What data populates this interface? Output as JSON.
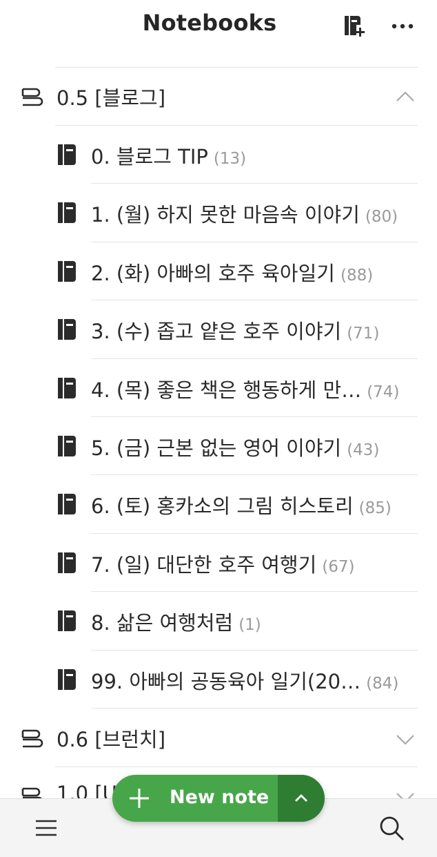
{
  "header": {
    "title": "Notebooks",
    "add_notebook_icon": "new-notebook-icon",
    "more_icon": "more-horizontal-icon"
  },
  "stacks": [
    {
      "label": "0.5 [블로그]",
      "expanded": true,
      "chevron": "chevron-up-icon"
    },
    {
      "label": "0.6 [브런치]",
      "expanded": false,
      "chevron": "chevron-down-icon"
    },
    {
      "label": "1.0 [U",
      "expanded": false,
      "chevron": "chevron-down-icon"
    }
  ],
  "notebooks": [
    {
      "name": "0. 블로그 TIP",
      "count": "(13)"
    },
    {
      "name": "1. (월) 하지 못한 마음속 이야기",
      "count": "(80)"
    },
    {
      "name": "2. (화) 아빠의 호주 육아일기",
      "count": "(88)"
    },
    {
      "name": "3. (수) 좁고 얕은 호주 이야기",
      "count": "(71)"
    },
    {
      "name": "4. (목) 좋은 책은 행동하게 만…",
      "count": "(74)"
    },
    {
      "name": "5. (금) 근본 없는 영어 이야기",
      "count": "(43)"
    },
    {
      "name": "6. (토) 홍카소의 그림 히스토리",
      "count": "(85)"
    },
    {
      "name": "7. (일) 대단한 호주 여행기",
      "count": "(67)"
    },
    {
      "name": "8. 삶은 여행처럼",
      "count": "(1)"
    },
    {
      "name": "99. 아빠의 공동육아 일기(20…",
      "count": "(84)"
    }
  ],
  "fab": {
    "label": "New note",
    "plus_icon": "plus-icon",
    "toggle_icon": "chevron-up-icon"
  },
  "bottom_bar": {
    "menu_icon": "hamburger-menu-icon",
    "search_icon": "search-icon"
  },
  "colors": {
    "accent_green": "#48a64a",
    "accent_green_dark": "#2f7d32",
    "count_gray": "#9a9a9a"
  }
}
